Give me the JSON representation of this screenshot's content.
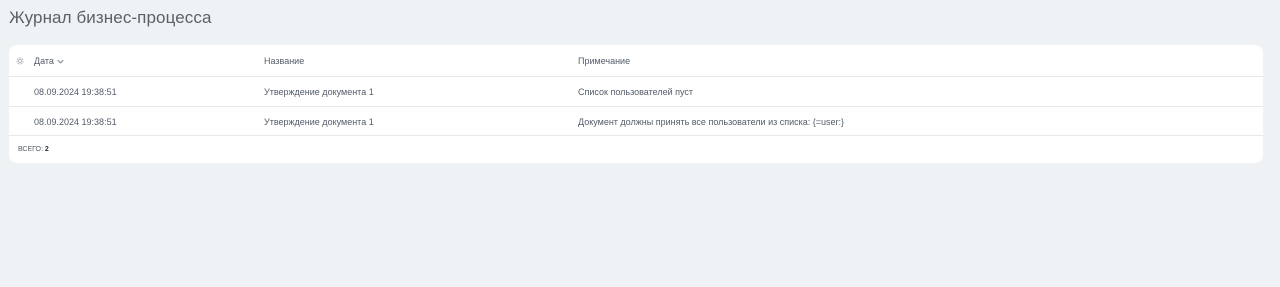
{
  "page": {
    "title": "Журнал бизнес-процесса"
  },
  "grid": {
    "columns": {
      "date": "Дата",
      "name": "Название",
      "note": "Примечание"
    },
    "rows": [
      {
        "date": "08.09.2024 19:38:51",
        "name": "Утверждение документа 1",
        "note": "Список пользователей пуст"
      },
      {
        "date": "08.09.2024 19:38:51",
        "name": "Утверждение документа 1",
        "note": "Документ должны принять все пользователи из списка: {=user:}"
      }
    ],
    "footer": {
      "total_label": "всего:",
      "total_value": "2"
    }
  },
  "icons": {
    "settings": "gear-icon",
    "sort": "chevron-down-icon"
  },
  "colors": {
    "background": "#eef2f4",
    "card": "#ffffff",
    "text": "#535c69",
    "divider": "#e6eaec"
  }
}
